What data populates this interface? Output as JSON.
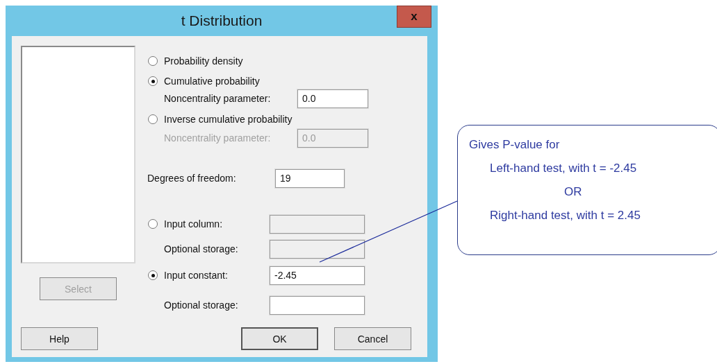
{
  "window": {
    "title": "t Distribution",
    "close": "x"
  },
  "select_button": {
    "label": "Select",
    "disabled": true
  },
  "mode_options": [
    {
      "label": "Probability density",
      "selected": false
    },
    {
      "label": "Cumulative probability",
      "selected": true,
      "parameter": {
        "label": "Noncentrality parameter:",
        "value": "0.0",
        "disabled": false
      }
    },
    {
      "label": "Inverse cumulative probability",
      "selected": false,
      "parameter": {
        "label": "Noncentrality parameter:",
        "value": "0.0",
        "disabled": true
      }
    }
  ],
  "degrees_of_freedom": {
    "label": "Degrees of freedom:",
    "value": "19"
  },
  "input_options": [
    {
      "label": "Input column:",
      "selected": false,
      "storage_label": "Optional storage:"
    },
    {
      "label": "Input constant:",
      "selected": true,
      "value": "-2.45",
      "storage_label": "Optional storage:"
    }
  ],
  "buttons": [
    {
      "label": "Help",
      "default": false
    },
    {
      "label": "OK",
      "default": true
    },
    {
      "label": "Cancel",
      "default": false
    }
  ],
  "callout": {
    "lines": [
      {
        "text": "Gives P-value for",
        "kind": "heading"
      },
      {
        "text": "Left-hand test, with t = -2.45",
        "kind": "case"
      },
      {
        "text": "OR",
        "kind": "separator"
      },
      {
        "text": "Right-hand test, with t = 2.45",
        "kind": "case"
      }
    ]
  }
}
